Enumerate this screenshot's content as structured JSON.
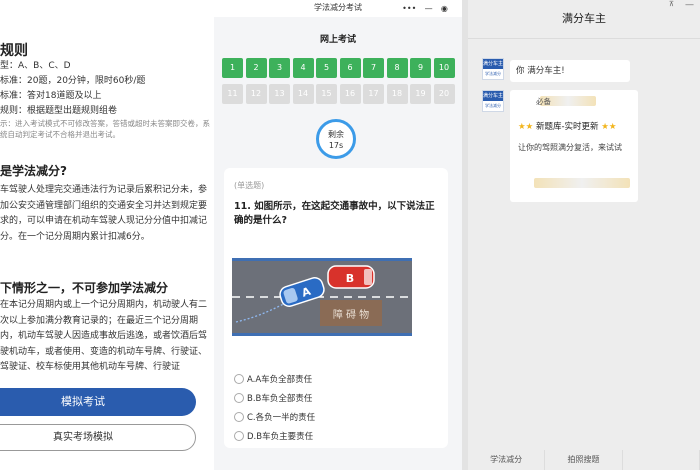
{
  "left": {
    "section_title": "规则",
    "rules": [
      {
        "label": "型：",
        "value": "A、B、C、D"
      },
      {
        "label": "标准：",
        "value": "20题，20分钟，限时60秒/题"
      },
      {
        "label": "标准：",
        "value": "答对18道题及以上"
      },
      {
        "label": "规则：",
        "value": "根据题型出题规则组卷"
      }
    ],
    "note": "示：进入考试模式不可修改答案，答错或超时未答案即交卷，系统自动判定考试不合格并退出考试。",
    "heading1": "是学法减分?",
    "para1": "车驾驶人处理完交通违法行为记录后累积记分未，参加公安交通管理部门组织的交通安全习并达到规定要求的，可以申请在机动车驾驶人现记分分值中扣减记分。在一个记分周期内累计扣减6分。",
    "heading2": "下情形之一，不可参加学法减分",
    "para2": "在本记分周期内或上一个记分周期内，机动驶人有二次以上参加满分教育记录的；在最近三个记分周期内，机动车驾驶人因造成事故后逃逸，或者饮酒后驾驶机动车，或者使用、变造的机动车号牌、行驶证、驾驶证、校车标使用其他机动车号牌、行驶证",
    "primary_button": "模拟考试",
    "secondary_button": "真实考场模拟"
  },
  "mid": {
    "app_title": "学法减分考试",
    "capsule": {
      "more": "•••",
      "minimize": "—",
      "close": "◉"
    },
    "exam_title": "网上考试",
    "answered": [
      "1",
      "2",
      "3",
      "4",
      "5",
      "6",
      "7",
      "8",
      "9",
      "10"
    ],
    "unanswered": [
      "11",
      "12",
      "13",
      "14",
      "15",
      "16",
      "17",
      "18",
      "19",
      "20"
    ],
    "timer_label": "剩余",
    "timer_value": "17s",
    "question_type": "(单选题)",
    "question": "11. 如图所示，在这起交通事故中，以下说法正确的是什么?",
    "car_a": "A",
    "car_b": "B",
    "obstacle": "障 碍 物",
    "options": [
      "A.A车负全部责任",
      "B.B车负全部责任",
      "C.各负一半的责任",
      "D.B车负主要责任"
    ]
  },
  "right": {
    "title": "满分车主",
    "pin": "⊼",
    "minimize": "—",
    "avatar_brand": "满分车主",
    "avatar_sub": "学法减分",
    "msg1": "你      满分车主!",
    "card_top": "      必备",
    "card_title": "新题库-实时更新",
    "card_sub": "让你的驾照满分复活，来试试",
    "tabs": [
      "学法减分",
      "拍照搜题",
      ""
    ]
  }
}
